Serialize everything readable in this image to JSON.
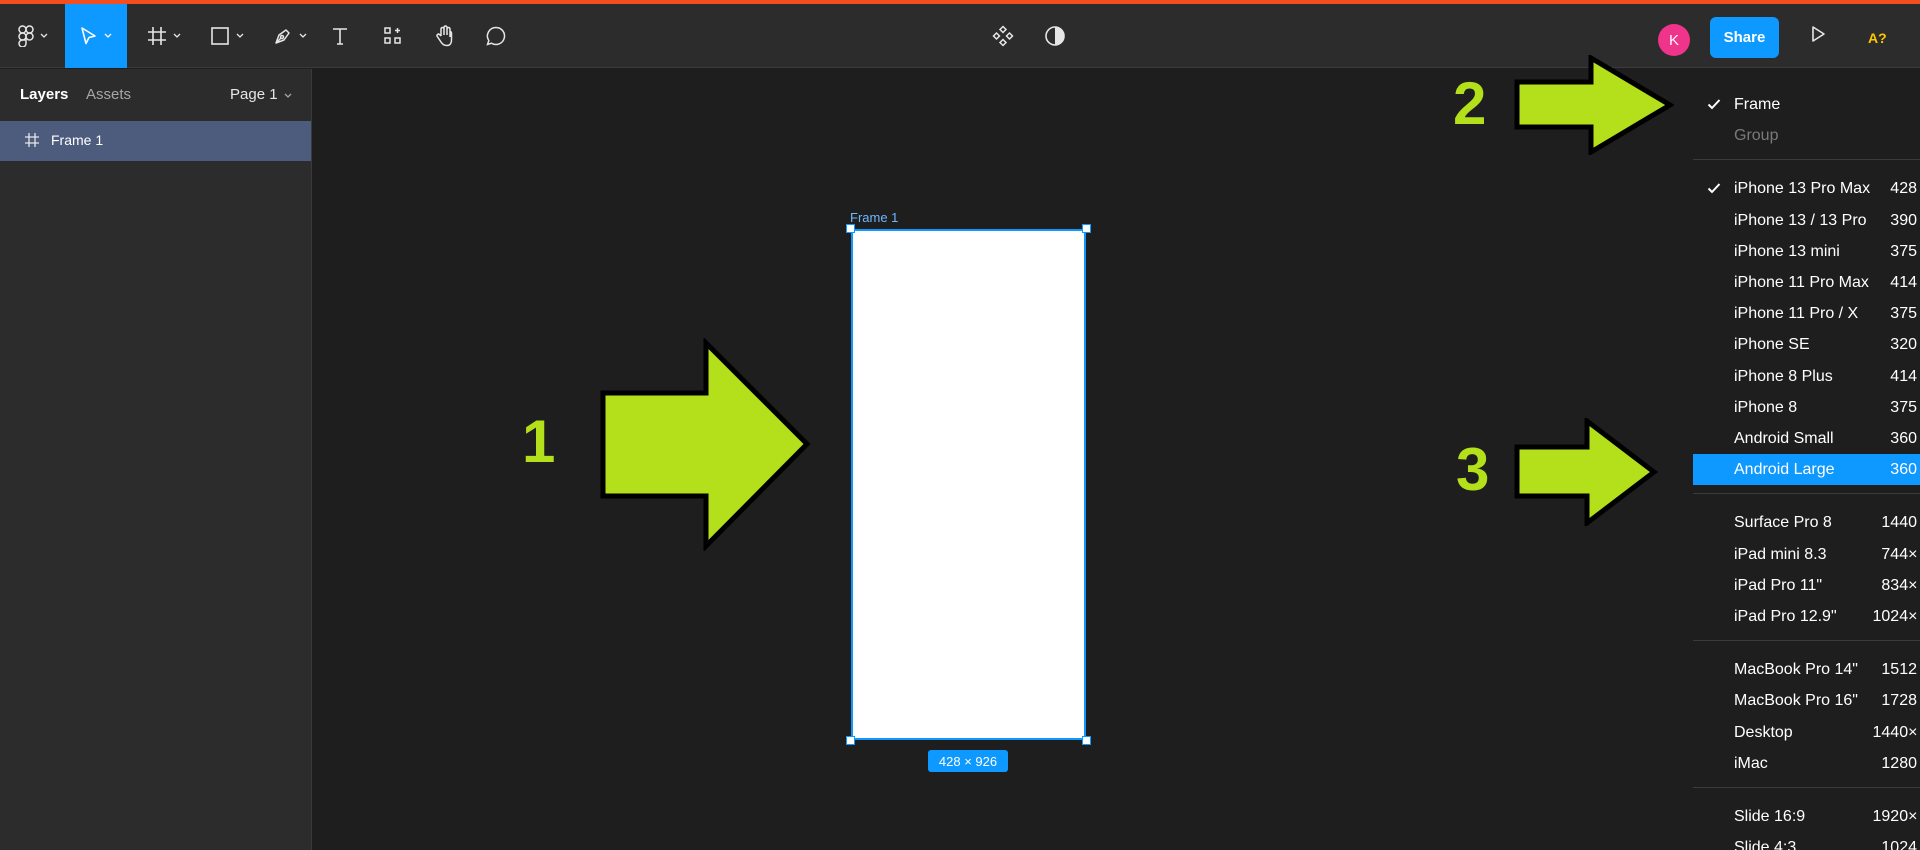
{
  "toolbar": {
    "tools": [
      {
        "name": "main-menu",
        "icon": "figma-logo-icon",
        "chevron": true
      },
      {
        "name": "move-tool",
        "icon": "cursor-icon",
        "chevron": true,
        "active": true
      },
      {
        "name": "frame-tool",
        "icon": "frame-hash-icon",
        "chevron": true
      },
      {
        "name": "shape-tool",
        "icon": "rectangle-icon",
        "chevron": true
      },
      {
        "name": "pen-tool",
        "icon": "pen-icon",
        "chevron": true
      },
      {
        "name": "text-tool",
        "icon": "text-icon",
        "chevron": false
      },
      {
        "name": "resources-tool",
        "icon": "components-icon",
        "chevron": false
      },
      {
        "name": "hand-tool",
        "icon": "hand-icon",
        "chevron": false
      },
      {
        "name": "comment-tool",
        "icon": "comment-icon",
        "chevron": false
      }
    ],
    "center_icons": [
      "component-icon",
      "contrast-icon"
    ],
    "avatar_initial": "K",
    "share_label": "Share",
    "font_warning": "A?"
  },
  "left_panel": {
    "tab_layers": "Layers",
    "tab_assets": "Assets",
    "page_label": "Page 1",
    "layers": [
      {
        "name": "Frame 1",
        "icon": "frame-hash-icon",
        "selected": true
      }
    ]
  },
  "canvas": {
    "frame_label": "Frame 1",
    "size_badge": "428 × 926"
  },
  "annotations": {
    "arrow_1": "1",
    "arrow_2": "2",
    "arrow_3": "3",
    "arrow_color": "#b4e01b"
  },
  "dropdown": {
    "groups": [
      [
        {
          "label": "Frame",
          "checked": true
        },
        {
          "label": "Group",
          "disabled": true
        }
      ],
      [
        {
          "label": "iPhone 13 Pro Max",
          "size": "428",
          "checked": true
        },
        {
          "label": "iPhone 13 / 13 Pro",
          "size": "390"
        },
        {
          "label": "iPhone 13 mini",
          "size": "375"
        },
        {
          "label": "iPhone 11 Pro Max",
          "size": "414"
        },
        {
          "label": "iPhone 11 Pro / X",
          "size": "375"
        },
        {
          "label": "iPhone SE",
          "size": "320"
        },
        {
          "label": "iPhone 8 Plus",
          "size": "414"
        },
        {
          "label": "iPhone 8",
          "size": "375"
        },
        {
          "label": "Android Small",
          "size": "360"
        },
        {
          "label": "Android Large",
          "size": "360",
          "selected": true
        }
      ],
      [
        {
          "label": "Surface Pro 8",
          "size": "1440"
        },
        {
          "label": "iPad mini 8.3",
          "size": "744×"
        },
        {
          "label": "iPad Pro 11\"",
          "size": "834×"
        },
        {
          "label": "iPad Pro 12.9\"",
          "size": "1024×"
        }
      ],
      [
        {
          "label": "MacBook Pro 14\"",
          "size": "1512"
        },
        {
          "label": "MacBook Pro 16\"",
          "size": "1728"
        },
        {
          "label": "Desktop",
          "size": "1440×"
        },
        {
          "label": "iMac",
          "size": "1280"
        }
      ],
      [
        {
          "label": "Slide 16:9",
          "size": "1920×"
        },
        {
          "label": "Slide 4:3",
          "size": "1024"
        }
      ]
    ]
  }
}
